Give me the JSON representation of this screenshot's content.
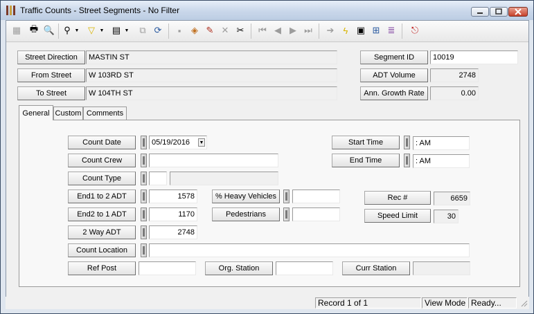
{
  "window": {
    "title": "Traffic Counts - Street Segments - No Filter"
  },
  "toolbar": {
    "icons": [
      "grid-icon",
      "print-icon",
      "print-preview-icon",
      "binoculars-icon",
      "filter-icon",
      "document-icon",
      "copy-icon",
      "refresh-icon",
      "save-icon",
      "load-icon",
      "edit-pencil-icon",
      "delete-x-icon",
      "cut-icon",
      "first-record-icon",
      "previous-record-icon",
      "next-record-icon",
      "last-record-icon",
      "goto-icon",
      "lightning-icon",
      "report-icon",
      "map-icon",
      "books-icon",
      "exit-icon"
    ]
  },
  "header": {
    "street_direction_label": "Street Direction",
    "street_direction_value": "MASTIN ST",
    "from_street_label": "From Street",
    "from_street_value": "W 103RD ST",
    "to_street_label": "To Street",
    "to_street_value": "W 104TH ST",
    "segment_id_label": "Segment ID",
    "segment_id_value": "10019",
    "adt_volume_label": "ADT Volume",
    "adt_volume_value": "2748",
    "growth_rate_label": "Ann. Growth Rate",
    "growth_rate_value": "0.00"
  },
  "tabs": [
    {
      "label": "General",
      "active": true
    },
    {
      "label": "Custom",
      "active": false
    },
    {
      "label": "Comments",
      "active": false
    }
  ],
  "general": {
    "count_date_label": "Count Date",
    "count_date_value": "05/19/2016",
    "count_crew_label": "Count Crew",
    "count_crew_value": "",
    "count_type_label": "Count Type",
    "count_type_code": "",
    "count_type_desc": "",
    "end1_label": "End1 to 2 ADT",
    "end1_value": "1578",
    "end2_label": "End2 to 1 ADT",
    "end2_value": "1170",
    "twoway_label": "2 Way ADT",
    "twoway_value": "2748",
    "count_location_label": "Count Location",
    "count_location_value": "",
    "heavy_label": "% Heavy Vehicles",
    "heavy_value": "",
    "ped_label": "Pedestrians",
    "ped_value": "",
    "start_time_label": "Start Time",
    "start_time_value": " :  AM",
    "end_time_label": "End Time",
    "end_time_value": " :  AM",
    "rec_label": "Rec #",
    "rec_value": "6659",
    "speed_label": "Speed Limit",
    "speed_value": "30",
    "ref_post_label": "Ref Post",
    "ref_post_value": "",
    "org_station_label": "Org. Station",
    "org_station_value": "",
    "curr_station_label": "Curr Station",
    "curr_station_value": ""
  },
  "status": {
    "record": "Record 1 of 1",
    "mode": "View Mode",
    "state": "Ready..."
  }
}
